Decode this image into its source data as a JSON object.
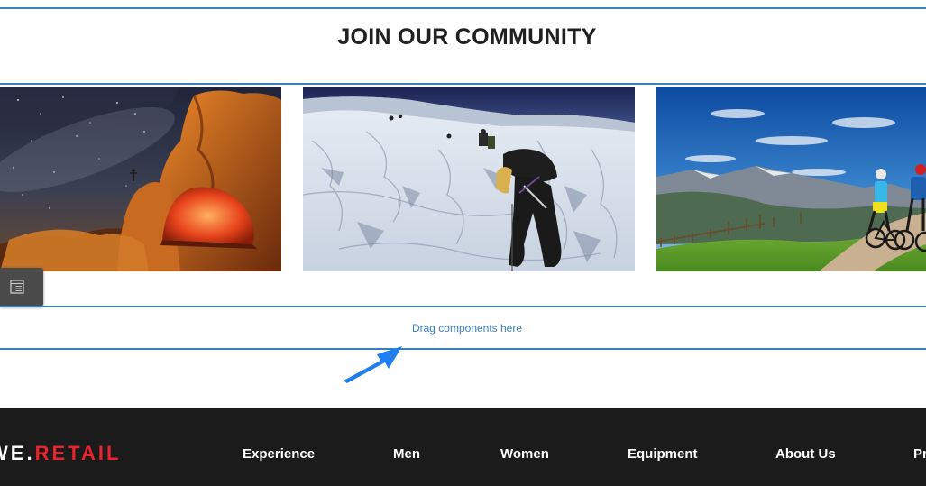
{
  "section": {
    "title": "JOIN OUR COMMUNITY"
  },
  "images": [
    {
      "name": "camping-tent-photo",
      "icon": "photo-camping-under-stars"
    },
    {
      "name": "ice-climbing-photo",
      "icon": "photo-glacier-climber"
    },
    {
      "name": "mountain-biking-photo",
      "icon": "photo-mountain-bikers"
    }
  ],
  "side_toolbar": {
    "icon": "component-browser-icon"
  },
  "drop_zone": {
    "label": "Drag components here"
  },
  "footer": {
    "logo_we": "WE",
    "logo_dot": ".",
    "logo_retail": "RETAIL",
    "nav": [
      "Experience",
      "Men",
      "Women",
      "Equipment",
      "About Us",
      "Pr"
    ]
  },
  "colors": {
    "accent_blue": "#3a7fc0",
    "arrow_blue": "#1f7ff0",
    "footer_bg": "#1b1b1b",
    "brand_red": "#e8242c",
    "toolbar_bg": "#4a4a4a"
  }
}
